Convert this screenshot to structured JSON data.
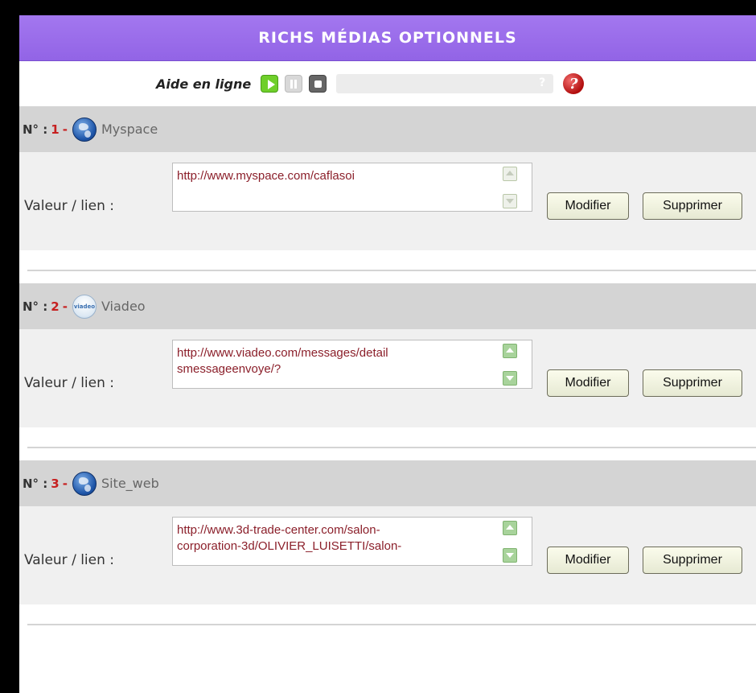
{
  "header": {
    "title": "RICHS MÉDIAS OPTIONNELS"
  },
  "help": {
    "label": "Aide en ligne",
    "progress_mark": "?",
    "help_icon_glyph": "?"
  },
  "entry_labels": {
    "number_prefix": "N° :",
    "separator": "-",
    "value_label": "Valeur / lien :"
  },
  "buttons": {
    "modify": "Modifier",
    "delete": "Supprimer"
  },
  "entries": [
    {
      "number": "1",
      "icon": "globe-icon",
      "name": "Myspace",
      "value_line1": "http://www.myspace.com/caflasoi",
      "value_line2": "",
      "scrollbar_active": false
    },
    {
      "number": "2",
      "icon": "viadeo-icon",
      "icon_text": "viadeo",
      "name": "Viadeo",
      "value_line1": "http://www.viadeo.com/messages/detail",
      "value_line2": "smessageenvoye/?",
      "scrollbar_active": true
    },
    {
      "number": "3",
      "icon": "globe-icon",
      "name": "Site_web",
      "value_line1": "http://www.3d-trade-center.com/salon-",
      "value_line2": "corporation-3d/OLIVIER_LUISETTI/salon-",
      "scrollbar_active": true
    }
  ],
  "colors": {
    "header_bg": "#9a6cea",
    "entry_header_bg": "#d4d4d4",
    "entry_body_bg": "#f0f0f0",
    "number_red": "#c62020",
    "link_text": "#8b1f2a",
    "play_green": "#6fcf2a"
  }
}
